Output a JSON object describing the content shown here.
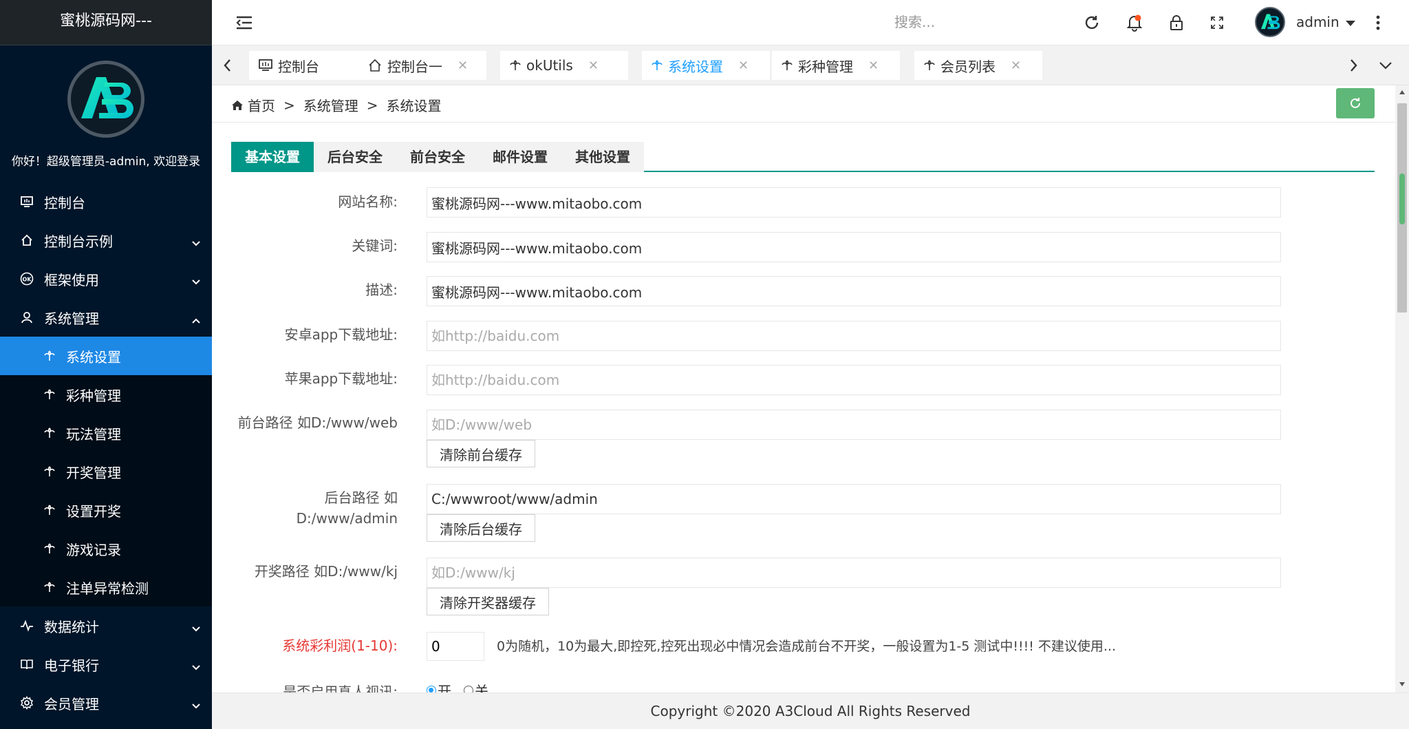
{
  "app": {
    "title": "蜜桃源码网---",
    "welcome": "你好！超级管理员-admin, 欢迎登录"
  },
  "sidebar": {
    "items": [
      {
        "label": "控制台",
        "icon": "monitor-icon",
        "expandable": false
      },
      {
        "label": "控制台示例",
        "icon": "home-icon",
        "expandable": true,
        "expanded": false
      },
      {
        "label": "框架使用",
        "icon": "ok-icon",
        "expandable": true,
        "expanded": false
      },
      {
        "label": "系统管理",
        "icon": "user-icon",
        "expandable": true,
        "expanded": true
      },
      {
        "label": "数据统计",
        "icon": "pulse-icon",
        "expandable": true,
        "expanded": false
      },
      {
        "label": "电子银行",
        "icon": "bank-icon",
        "expandable": true,
        "expanded": false
      },
      {
        "label": "会员管理",
        "icon": "gear-icon",
        "expandable": true,
        "expanded": false
      }
    ],
    "sub_items": [
      {
        "label": "系统设置",
        "active": true
      },
      {
        "label": "彩种管理"
      },
      {
        "label": "玩法管理"
      },
      {
        "label": "开奖管理"
      },
      {
        "label": "设置开奖"
      },
      {
        "label": "游戏记录"
      },
      {
        "label": "注单异常检测"
      }
    ]
  },
  "topbar": {
    "search_placeholder": "搜索...",
    "username": "admin"
  },
  "tabs": [
    {
      "label": "控制台",
      "icon": "monitor-icon",
      "closable": false
    },
    {
      "label": "控制台一",
      "icon": "home-icon",
      "closable": true
    },
    {
      "label": "okUtils",
      "icon": "palm-icon",
      "closable": true
    },
    {
      "label": "系统设置",
      "icon": "palm-icon",
      "closable": true,
      "active": true
    },
    {
      "label": "彩种管理",
      "icon": "palm-icon",
      "closable": true
    },
    {
      "label": "会员列表",
      "icon": "palm-icon",
      "closable": true
    }
  ],
  "breadcrumb": {
    "home": "首页",
    "sep": ">",
    "level1": "系统管理",
    "level2": "系统设置"
  },
  "subtabs": [
    "基本设置",
    "后台安全",
    "前台安全",
    "邮件设置",
    "其他设置"
  ],
  "form": {
    "site_name": {
      "label": "网站名称:",
      "value": "蜜桃源码网---www.mitaobo.com"
    },
    "keywords": {
      "label": "关键词:",
      "value": "蜜桃源码网---www.mitaobo.com"
    },
    "description": {
      "label": "描述:",
      "value": "蜜桃源码网---www.mitaobo.com"
    },
    "android_url": {
      "label": "安卓app下载地址:",
      "value": "",
      "placeholder": "如http://baidu.com"
    },
    "ios_url": {
      "label": "苹果app下载地址:",
      "value": "",
      "placeholder": "如http://baidu.com"
    },
    "front_path": {
      "label": "前台路径 如D:/www/web",
      "value": "",
      "placeholder": "如D:/www/web",
      "button": "清除前台缓存"
    },
    "admin_path": {
      "label_line1": "后台路径 如",
      "label_line2": "D:/www/admin",
      "value": "C:/wwwroot/www/admin",
      "button": "清除后台缓存"
    },
    "draw_path": {
      "label": "开奖路径 如D:/www/kj",
      "value": "",
      "placeholder": "如D:/www/kj",
      "button": "清除开奖器缓存"
    },
    "profit": {
      "label": "系统彩利润(1-10):",
      "value": "0",
      "hint": "0为随机，10为最大,即控死,控死出现必中情况会造成前台不开奖，一般设置为1-5 测试中!!!! 不建议使用..."
    },
    "real_video": {
      "label": "是否启用真人视讯:",
      "on_label": "开",
      "off_label": "关",
      "selected": "开"
    }
  },
  "footer": {
    "text": "Copyright ©2020 A3Cloud All Rights Reserved"
  },
  "colors": {
    "sidebar_bg": "#001529",
    "active_blue": "#1e88e5",
    "teal": "#009688",
    "green": "#5fb878",
    "red_label": "#e53935"
  }
}
